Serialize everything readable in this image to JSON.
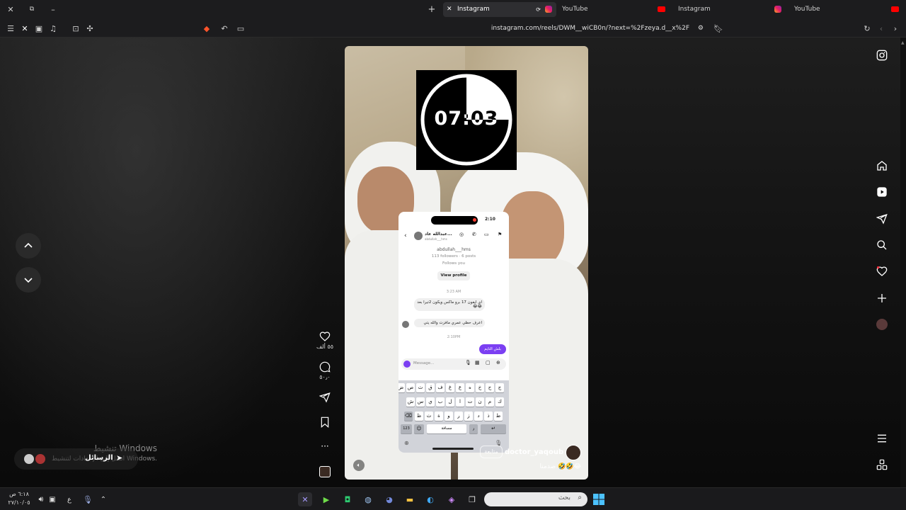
{
  "browser": {
    "tabs": [
      {
        "label": "Instagram",
        "active": true
      },
      {
        "label": "YouTube",
        "active": false
      },
      {
        "label": "Instagram",
        "active": false
      },
      {
        "label": "YouTube",
        "active": false
      }
    ],
    "url": "instagram.com/reels/DWM__wiCB0n/?next=%2Fzeya.d__x%2F"
  },
  "timer": {
    "display": "07:03"
  },
  "video": {
    "username": "doctor_yaqoub",
    "follow_label": "متابعة",
    "caption": "صدمنا 🤣🤣😂"
  },
  "phone": {
    "time": "2:10",
    "contact_name": "عبدالله عاد...",
    "contact_handle": "abdullah___hms",
    "handle": "abdullah___hms",
    "stats": "113 followers · 6 posts",
    "follows_you": "Follows you",
    "view_profile": "View profile",
    "time1": "3:23 AM",
    "msg1": "اي ايفون 17 برو ماكس ويكون 2تيرا بعد 😂😂",
    "msg2": "اعرف حظي عمري مافزت والله يتي",
    "time2": "2:10PM",
    "msg3": "بلش التايم",
    "message_placeholder": "Message...",
    "keyboard": {
      "row1": [
        "ج",
        "ح",
        "خ",
        "ه",
        "ع",
        "غ",
        "ف",
        "ق",
        "ث",
        "ص",
        "ض"
      ],
      "row2": [
        "ك",
        "م",
        "ن",
        "ت",
        "ا",
        "ل",
        "ب",
        "ي",
        "س",
        "ش"
      ],
      "row3": [
        "ط",
        "ذ",
        "د",
        "ز",
        "ر",
        "و",
        "ة",
        "ث",
        "ظ"
      ],
      "num_key": "123",
      "space": "مسافة"
    }
  },
  "actions": {
    "likes": "٥٥ ألف",
    "comments": "٥٠٫٠"
  },
  "activation": {
    "title": "تنشيط Windows",
    "subtitle": "انتقل إلى الإعدادات لتنشيط Windows."
  },
  "messages_bar": {
    "label": "الرسائل"
  },
  "taskbar": {
    "time": "٦:١٨ ص",
    "date": "٢٧/١٠/٠٥",
    "lang": "ع",
    "search_placeholder": "بحث"
  },
  "colors": {
    "accent": "#7b3ff2",
    "record": "#ff3b30"
  }
}
